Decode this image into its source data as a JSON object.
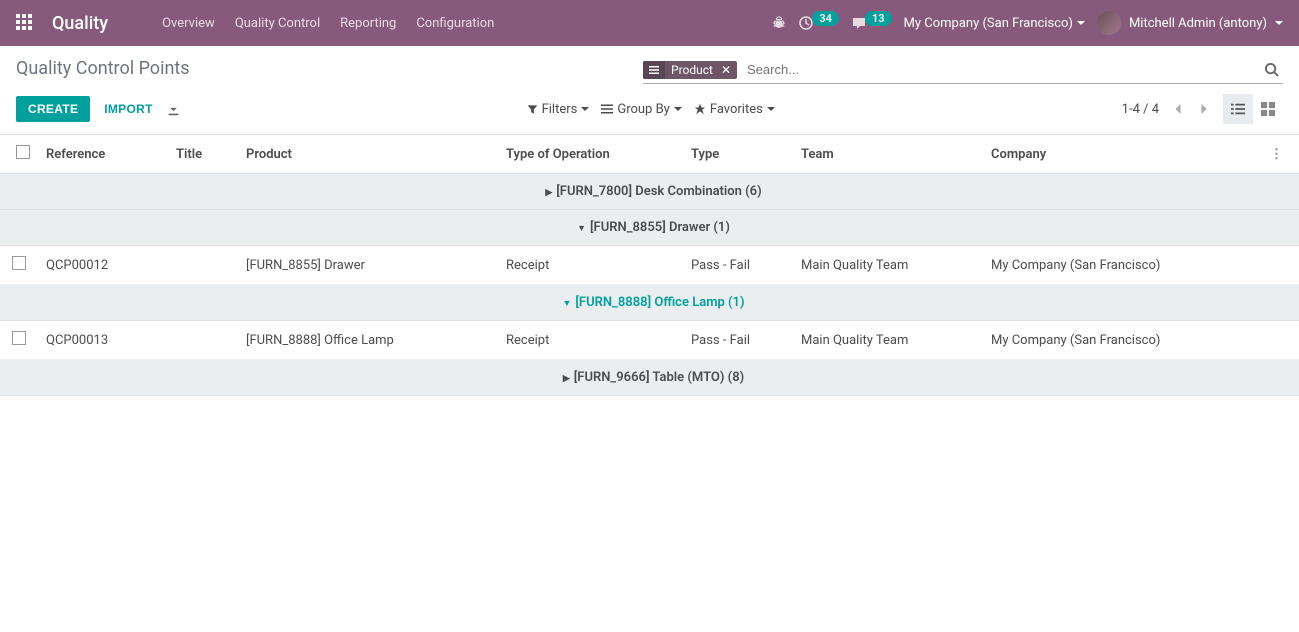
{
  "navbar": {
    "brand": "Quality",
    "links": [
      "Overview",
      "Quality Control",
      "Reporting",
      "Configuration"
    ],
    "badge1": "34",
    "badge2": "13",
    "company": "My Company (San Francisco)",
    "user": "Mitchell Admin (antony)"
  },
  "breadcrumb": "Quality Control Points",
  "search": {
    "facet_label": "Product",
    "placeholder": "Search..."
  },
  "buttons": {
    "create": "CREATE",
    "import": "IMPORT"
  },
  "toolbar": {
    "filters": "Filters",
    "groupby": "Group By",
    "favorites": "Favorites"
  },
  "pager": "1-4 / 4",
  "columns": {
    "reference": "Reference",
    "title": "Title",
    "product": "Product",
    "operation": "Type of Operation",
    "type": "Type",
    "team": "Team",
    "company": "Company"
  },
  "groups": [
    {
      "label": "[FURN_7800] Desk Combination (6)",
      "expanded": false,
      "active": false,
      "rows": []
    },
    {
      "label": "[FURN_8855] Drawer (1)",
      "expanded": true,
      "active": false,
      "rows": [
        {
          "reference": "QCP00012",
          "title": "",
          "product": "[FURN_8855] Drawer",
          "operation": "Receipt",
          "type": "Pass - Fail",
          "team": "Main Quality Team",
          "company": "My Company (San Francisco)"
        }
      ]
    },
    {
      "label": "[FURN_8888] Office Lamp (1)",
      "expanded": true,
      "active": true,
      "rows": [
        {
          "reference": "QCP00013",
          "title": "",
          "product": "[FURN_8888] Office Lamp",
          "operation": "Receipt",
          "type": "Pass - Fail",
          "team": "Main Quality Team",
          "company": "My Company (San Francisco)"
        }
      ]
    },
    {
      "label": "[FURN_9666] Table (MTO) (8)",
      "expanded": false,
      "active": false,
      "rows": []
    }
  ]
}
